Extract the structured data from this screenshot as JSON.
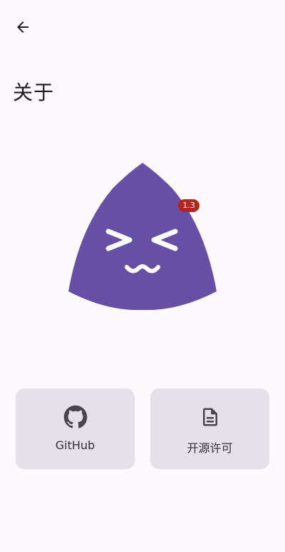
{
  "header": {
    "back_icon": "arrow-back-icon",
    "title": "关于"
  },
  "app": {
    "logo_icon": "app-logo-face-icon",
    "version": "1.3",
    "colors": {
      "logo": "#6750a4",
      "badge": "#b3261e",
      "card": "#e6e0e9",
      "background": "#fdf8fc"
    }
  },
  "links": [
    {
      "label": "GitHub",
      "icon": "github-icon"
    },
    {
      "label": "开源许可",
      "icon": "document-icon"
    }
  ]
}
